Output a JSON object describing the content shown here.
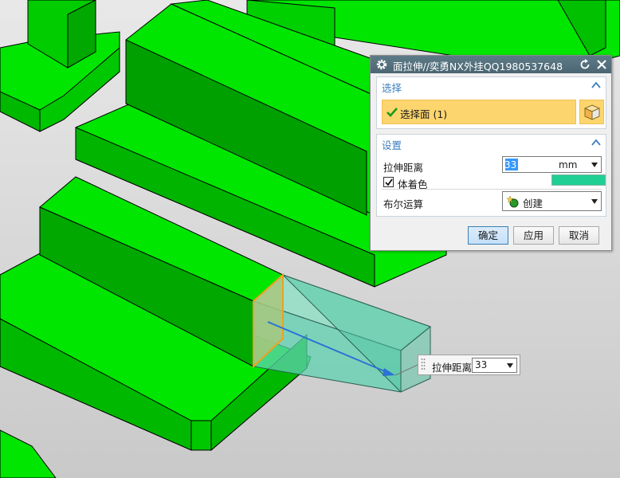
{
  "dialog": {
    "title": "面拉伸//奕勇NX外挂QQ1980537648",
    "sections": {
      "select": {
        "title": "选择",
        "face_label": "选择面 (1)"
      },
      "settings": {
        "title": "设置",
        "distance_label": "拉伸距离",
        "distance_value": "33",
        "distance_unit": "mm",
        "color_label": "体着色",
        "color_checked": true,
        "color_value": "#1fcf94",
        "boolean_label": "布尔运算",
        "boolean_value": "创建"
      }
    },
    "buttons": {
      "ok": "确定",
      "apply": "应用",
      "cancel": "取消"
    }
  },
  "floating_dim": {
    "label": "拉伸距离",
    "value": "33"
  },
  "colors": {
    "model_green": "#00e600",
    "preview": "#5fd1b0",
    "title_bar": "#4f6b77",
    "section_title": "#3d7fbf",
    "highlight": "#fdd56e"
  }
}
